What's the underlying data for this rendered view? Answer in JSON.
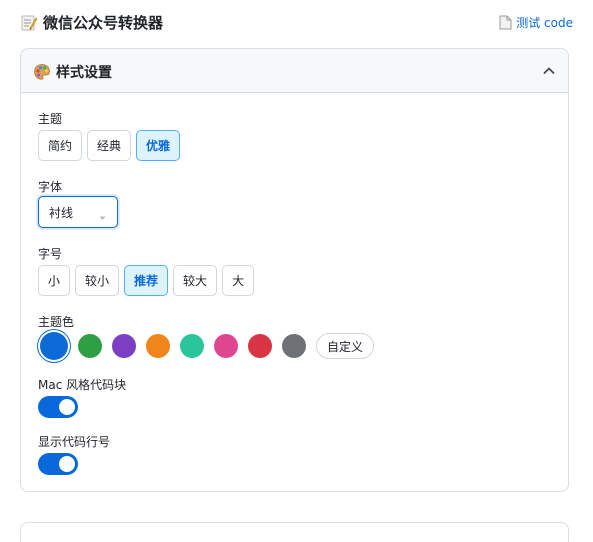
{
  "header": {
    "icon": "memo-icon",
    "title": "微信公众号转换器",
    "test_link": {
      "icon": "document-icon",
      "label": "测试 code"
    }
  },
  "panel": {
    "icon": "palette-icon",
    "title": "样式设置",
    "collapse_icon": "chevron-up-icon",
    "theme": {
      "label": "主题",
      "options": [
        "简约",
        "经典",
        "优雅"
      ],
      "selected": "优雅"
    },
    "font": {
      "label": "字体",
      "value": "衬线"
    },
    "font_size": {
      "label": "字号",
      "options": [
        "小",
        "较小",
        "推荐",
        "较大",
        "大"
      ],
      "selected": "推荐"
    },
    "theme_color": {
      "label": "主题色",
      "swatches": [
        "#0b6ad6",
        "#2ea043",
        "#7c3fc4",
        "#f0861a",
        "#2ac59a",
        "#e0458f",
        "#d93444",
        "#6e7175"
      ],
      "selected": "#0b6ad6",
      "custom_label": "自定义"
    },
    "mac_code_block": {
      "label": "Mac 风格代码块",
      "enabled": true
    },
    "line_numbers": {
      "label": "显示代码行号",
      "enabled": true
    }
  },
  "colors": {
    "accent": "#0969da",
    "active_bg": "#ddf4ff",
    "border": "#d0d7de"
  }
}
